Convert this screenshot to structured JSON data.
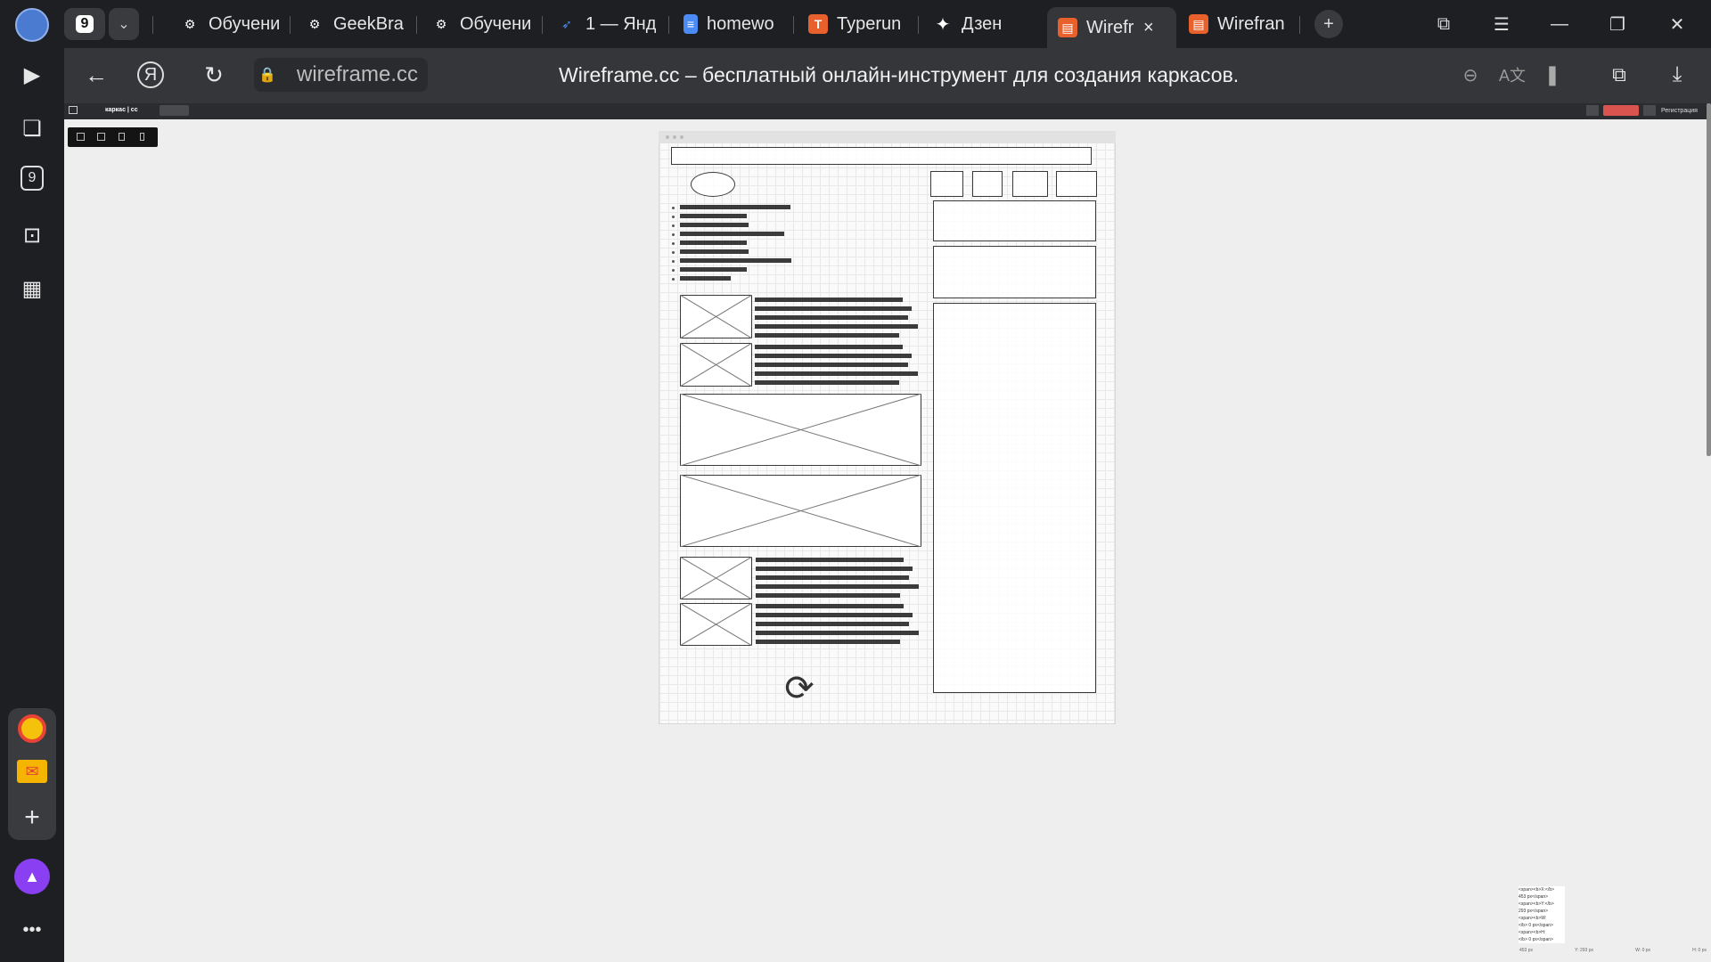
{
  "browser": {
    "tab_count": "9",
    "tabs": [
      {
        "label": "Обучени",
        "icon": "openai-icon"
      },
      {
        "label": "GeekBra",
        "icon": "openai-icon"
      },
      {
        "label": "Обучени",
        "icon": "openai-icon"
      },
      {
        "label": "1 — Янд",
        "icon": "yandex-feather-icon"
      },
      {
        "label": "homewo",
        "icon": "document-icon"
      },
      {
        "label": "Typerun",
        "icon": "typerun-icon"
      },
      {
        "label": "Дзен",
        "icon": "zen-star-icon"
      },
      {
        "label": "Wirefr",
        "icon": "wireframe-icon",
        "active": true
      },
      {
        "label": "Wirefran",
        "icon": "wireframe-icon"
      }
    ],
    "url": "wireframe.cc",
    "page_title": "Wireframe.cc – бесплатный онлайн-инструмент для создания каркасов.",
    "accent": "#e8612c"
  },
  "app": {
    "logo": "каркас | сс",
    "register_label": "Регистрация",
    "info_lines": [
      "<span><b>X:</b>",
      "453 px</span>",
      "<span><b>Y:</b>",
      "293 px</span>",
      "<span><b>W:",
      "</b> 0 px</span>",
      "<span><b>H:",
      "</b> 0 px</span>"
    ],
    "status": {
      "x": "453 px",
      "y": "Y: 293 px",
      "w": "W: 0 px",
      "h": "H: 0 px"
    }
  }
}
